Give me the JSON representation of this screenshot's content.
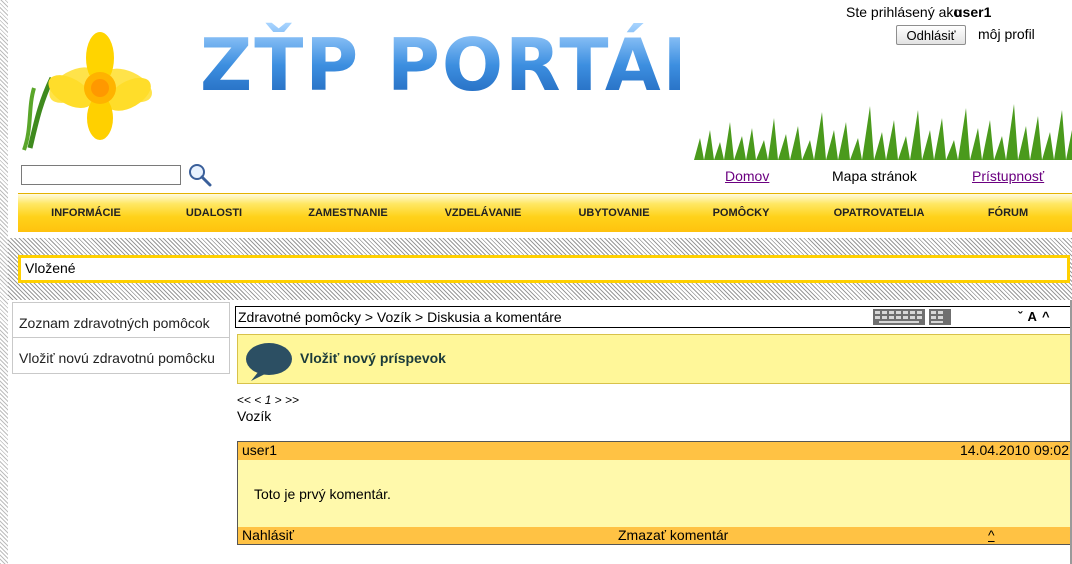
{
  "header": {
    "logo_text": "ZŤP PORTÁL",
    "logged_in_text": "Ste prihlásený ako",
    "username": "user1",
    "logout_label": "Odhlásiť",
    "profile_label": "môj profil",
    "search_placeholder": ""
  },
  "top_links": {
    "home": "Domov",
    "sitemap": "Mapa stránok",
    "accessibility": "Prístupnosť"
  },
  "nav": {
    "items": [
      "INFORMÁCIE",
      "UDALOSTI",
      "ZAMESTNANIE",
      "VZDELÁVANIE",
      "UBYTOVANIE",
      "POMÔCKY",
      "OPATROVATELIA",
      "FÓRUM"
    ]
  },
  "inserted_label": "Vložené",
  "sidebar": {
    "items": [
      "Zoznam zdravotných pomôcok",
      "Vložiť novú zdravotnú pomôcku"
    ]
  },
  "breadcrumb": "Zdravotné pomôcky > Vozík > Diskusia a komentáre",
  "font_controls": "ˇ A ^",
  "new_post_label": "Vložiť nový príspevok",
  "pager": {
    "prev": "<< <",
    "current": "1",
    "next": "> >>"
  },
  "subject": "Vozík",
  "comment": {
    "author": "user1",
    "date": "14.04.2010 09:02",
    "text": "Toto je prvý komentár.",
    "report_label": "Nahlásiť",
    "delete_label": "Zmazať komentár",
    "up_label": "^"
  },
  "colors": {
    "nav_yellow": "#ffd21a",
    "comment_bg": "#fff9ab",
    "comment_bar": "#ffc244",
    "link_visited": "#6b0080"
  }
}
